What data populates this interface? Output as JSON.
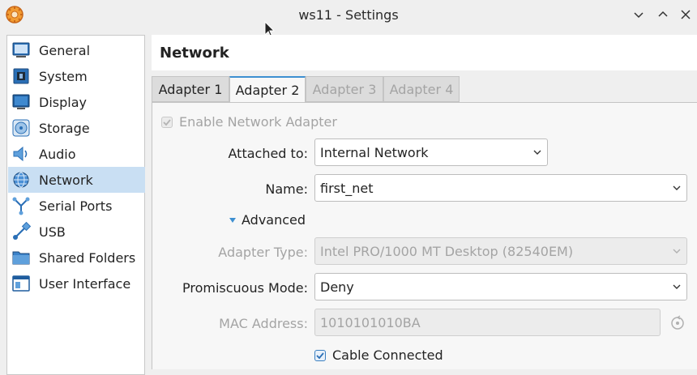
{
  "window": {
    "title": "ws11 - Settings",
    "buttons": [
      "minimize",
      "maximize",
      "close"
    ]
  },
  "sidebar": {
    "items": [
      {
        "label": "General",
        "icon": "general-icon"
      },
      {
        "label": "System",
        "icon": "system-icon"
      },
      {
        "label": "Display",
        "icon": "display-icon"
      },
      {
        "label": "Storage",
        "icon": "storage-icon"
      },
      {
        "label": "Audio",
        "icon": "audio-icon"
      },
      {
        "label": "Network",
        "icon": "network-icon",
        "selected": true
      },
      {
        "label": "Serial Ports",
        "icon": "serial-ports-icon"
      },
      {
        "label": "USB",
        "icon": "usb-icon"
      },
      {
        "label": "Shared Folders",
        "icon": "folder-icon"
      },
      {
        "label": "User Interface",
        "icon": "user-interface-icon"
      }
    ]
  },
  "page": {
    "title": "Network"
  },
  "tabs": [
    {
      "label": "Adapter 1",
      "state": "normal"
    },
    {
      "label": "Adapter 2",
      "state": "active"
    },
    {
      "label": "Adapter 3",
      "state": "disabled"
    },
    {
      "label": "Adapter 4",
      "state": "disabled"
    }
  ],
  "form": {
    "enable_adapter": {
      "label": "Enable Network Adapter",
      "checked": true,
      "disabled": true
    },
    "attached_to": {
      "label": "Attached to:",
      "value": "Internal Network"
    },
    "name": {
      "label": "Name:",
      "value": "first_net"
    },
    "advanced": {
      "label": "Advanced",
      "expanded": true
    },
    "adapter_type": {
      "label": "Adapter Type:",
      "value": "Intel PRO/1000 MT Desktop (82540EM)",
      "disabled": true
    },
    "promiscuous_mode": {
      "label": "Promiscuous Mode:",
      "value": "Deny"
    },
    "mac_address": {
      "label": "MAC Address:",
      "value": "1010101010BA",
      "disabled": true
    },
    "cable_connected": {
      "label": "Cable Connected",
      "checked": true
    }
  },
  "colors": {
    "accent": "#3d8fd1",
    "selected_bg": "#c9dff3",
    "window_bg": "#efefef",
    "disabled_text": "#a4a4a4"
  }
}
